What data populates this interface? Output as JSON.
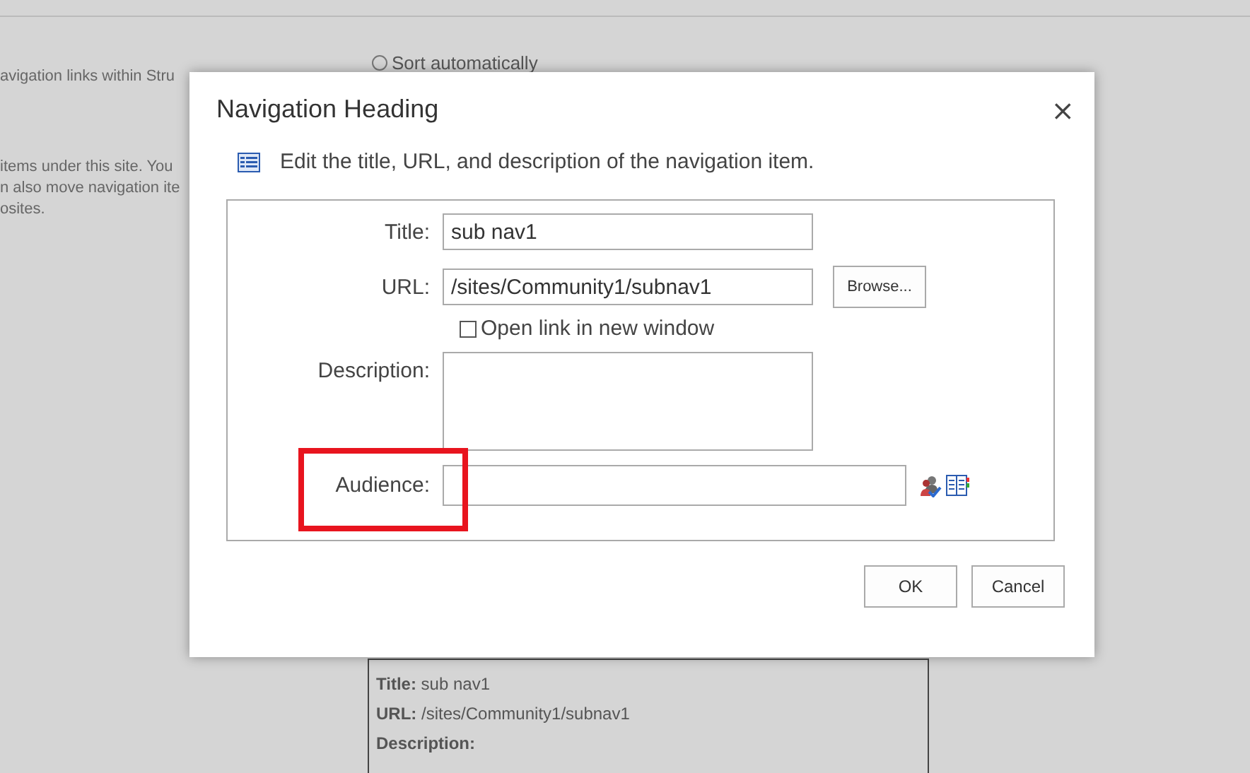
{
  "background": {
    "sort_option": {
      "label": "Sort automatically",
      "selected": false
    },
    "description_lines": [
      "avigation links within Stru",
      "items under this site. You",
      "n also move navigation ite",
      "osites."
    ],
    "preview": [
      "**Title:** sub nav1",
      "**URL:** /sites/Community1/subnav1",
      "**Description:**"
    ]
  },
  "dialog": {
    "title": "Navigation Heading",
    "close": "×",
    "instruction": "Edit the title, URL, and description of the navigation item.",
    "fields": [
      {
        "kind": "text",
        "label": "Title:",
        "value": "sub nav1"
      },
      {
        "kind": "url",
        "label": "URL:",
        "value": "/sites/Community1/subnav1",
        "button": "Browse..."
      },
      {
        "kind": "checkbox",
        "label": "Open link in new window",
        "checked": false
      },
      {
        "kind": "textarea",
        "label": "Description:"
      },
      {
        "kind": "audience",
        "label": "Audience:",
        "highlighted": true
      }
    ],
    "buttons": [
      "OK",
      "Cancel"
    ]
  }
}
